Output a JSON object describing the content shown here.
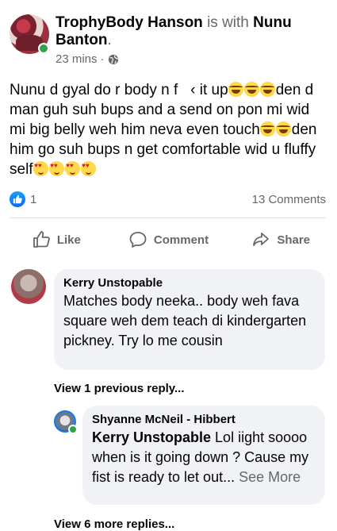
{
  "post": {
    "author": "TrophyBody Hanson",
    "with_text": "is with",
    "tagged": "Nunu Banton",
    "period": ".",
    "time": "23 mins",
    "dot": "·",
    "privacy_icon": "globe-icon",
    "text_parts": [
      {
        "t": "Nunu d gyal do r body n f "
      },
      {
        "t": "  "
      },
      {
        "t": "‹ it up"
      },
      {
        "e": "laugh"
      },
      {
        "e": "laugh"
      },
      {
        "e": "laugh"
      },
      {
        "t": "den d man guh suh bups and a send on pon mi wid mi big belly weh him neva even touch"
      },
      {
        "e": "laugh"
      },
      {
        "e": "laugh"
      },
      {
        "t": "den him go suh bups n get comfortable wid u fluffy self"
      },
      {
        "e": "hearts"
      },
      {
        "e": "hearts"
      },
      {
        "e": "hearts"
      },
      {
        "e": "hearts"
      }
    ],
    "reaction_count": "1",
    "comments_count": "13 Comments"
  },
  "actions": {
    "like": "Like",
    "comment": "Comment",
    "share": "Share"
  },
  "comments": {
    "first": {
      "name": "Kerry Unstopable",
      "text": "Matches body neeka.. body weh fava square weh dem teach di kindergarten pickney. Try lo me cousin"
    },
    "view_previous": "View 1 previous reply...",
    "reply": {
      "name": "Shyanne McNeil - Hibbert",
      "mention": "Kerry Unstopable",
      "text": " Lol iight soooo when is it going down ? Cause my fist is ready to let out...",
      "see_more": " See More"
    },
    "view_more": "View 6 more replies..."
  },
  "colors": {
    "facebook_blue": "#0866ff",
    "online_green": "#31a24c",
    "secondary_text": "#65676b",
    "bubble_bg": "#f0f2f5"
  }
}
